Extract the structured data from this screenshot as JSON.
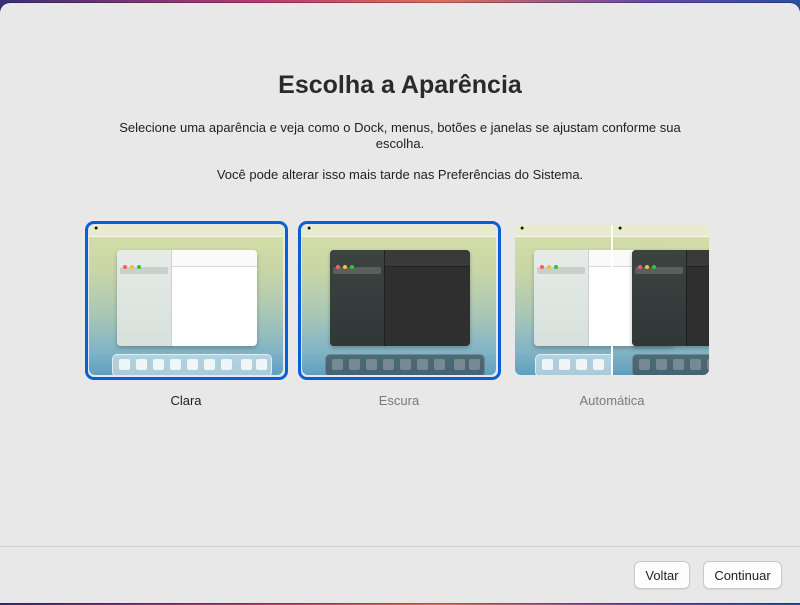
{
  "header": {
    "title": "Escolha a Aparência",
    "description": "Selecione uma aparência e veja como o Dock, menus, botões e janelas se ajustam conforme sua escolha.",
    "note": "Você pode alterar isso mais tarde nas Preferências do Sistema."
  },
  "appearance_options": [
    {
      "label": "Clara",
      "state": "selected"
    },
    {
      "label": "Escura",
      "state": "unselected"
    },
    {
      "label": "Automática",
      "state": "unselected"
    }
  ],
  "footer": {
    "back_label": "Voltar",
    "continue_label": "Continuar"
  },
  "colors": {
    "selection_ring": "#0b5fd6",
    "window_bg": "#e8e8e8"
  },
  "icons": [
    "apple-icon",
    "window-traffic-lights-icon",
    "dock-icon"
  ]
}
